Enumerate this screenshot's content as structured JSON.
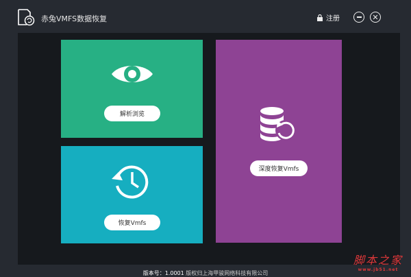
{
  "app": {
    "title": "赤兔VMFS数据恢复",
    "register_label": "注册"
  },
  "tiles": {
    "parse_browse": {
      "label": "解析浏览",
      "color": "#27b084"
    },
    "recover_vmfs": {
      "label": "恢复Vmfs",
      "color": "#16aec0"
    },
    "deep_recover_vmfs": {
      "label": "深度恢复Vmfs",
      "color": "#8e4394"
    }
  },
  "footer": {
    "version_label": "版本号：",
    "version": "1.0001",
    "copyright": "版权归上海甲骏网络科技有限公司"
  },
  "watermark": {
    "text": "脚本之家",
    "url": "www.jb51.net"
  }
}
